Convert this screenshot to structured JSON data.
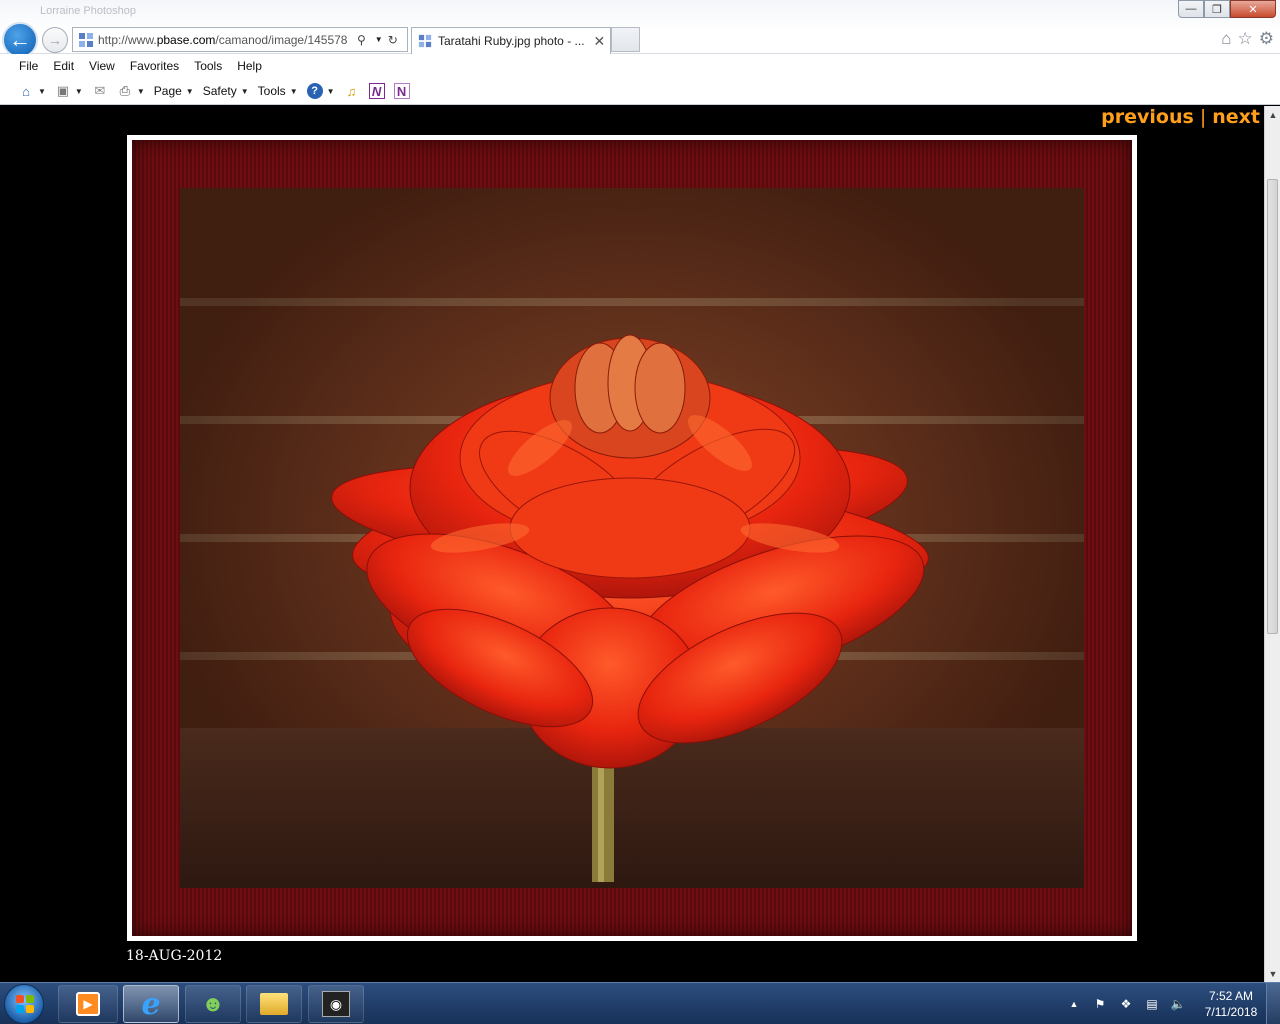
{
  "window": {
    "faint_title": "Lorraine Photoshop",
    "minimize": "—",
    "maximize": "❐",
    "close": "✕"
  },
  "browser": {
    "address_prefix": "http://www.",
    "address_host": "pbase.com",
    "address_path": "/camanod/image/145578",
    "search_glyph": "⚲",
    "refresh_glyph": "↻",
    "tab_label": "Taratahi Ruby.jpg photo - ...",
    "tab_close": "✕",
    "menu": [
      "File",
      "Edit",
      "View",
      "Favorites",
      "Tools",
      "Help"
    ],
    "commands": {
      "page": "Page",
      "safety": "Safety",
      "tools": "Tools",
      "help_glyph": "?",
      "onenote_a": "N",
      "onenote_b": "N"
    },
    "right_icons": {
      "home": "⌂",
      "favorites": "☆",
      "settings": "⚙"
    }
  },
  "page": {
    "previous": "previous",
    "separator": "|",
    "next": "next",
    "date": "18-AUG-2012"
  },
  "taskbar": {
    "tray_expand": "▲",
    "time": "7:52 AM",
    "date": "7/11/2018"
  },
  "colors": {
    "nav_link": "#ff9f1c",
    "flower_red": "#e8250f",
    "mat_red": "#6d0e12",
    "taskbar": "#1f3d68"
  }
}
